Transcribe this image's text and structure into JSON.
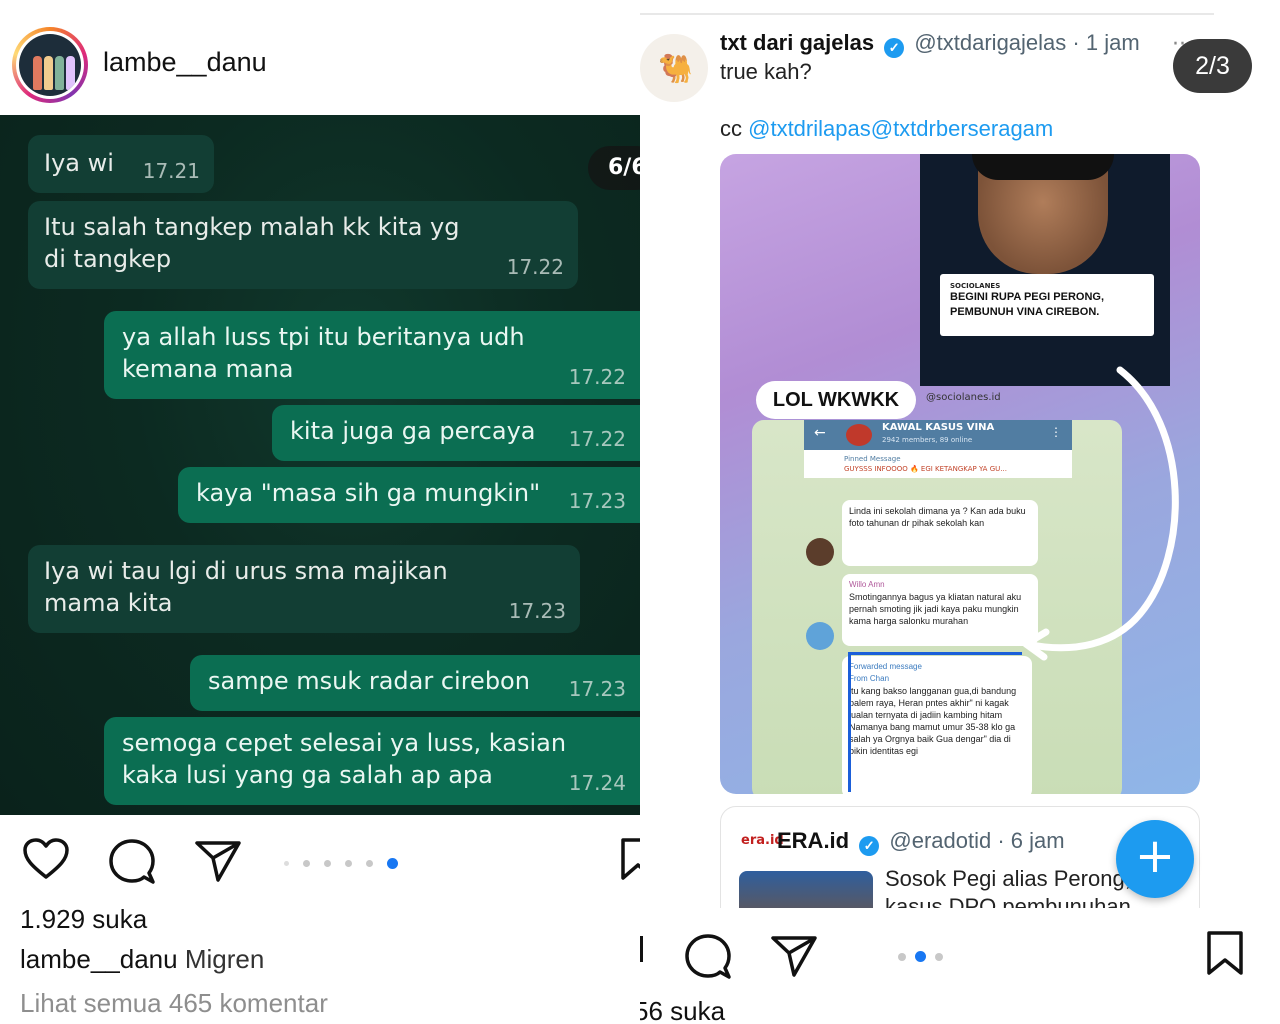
{
  "left_post": {
    "username": "lambe__danu",
    "slide_counter": "6/6",
    "messages": [
      {
        "dir": "in",
        "text": "Iya wi",
        "time": "17.21"
      },
      {
        "dir": "in",
        "text": "Itu salah tangkep malah kk kita yg di tangkep",
        "time": "17.22"
      },
      {
        "dir": "out",
        "text": "ya allah luss  tpi itu beritanya udh kemana mana",
        "time": "17.22"
      },
      {
        "dir": "out",
        "text": "kita juga ga percaya",
        "time": "17.22"
      },
      {
        "dir": "out",
        "text": "kaya \"masa sih ga mungkin\"",
        "time": "17.23"
      },
      {
        "dir": "in",
        "text": "Iya wi tau lgi di urus sma majikan mama kita",
        "time": "17.23"
      },
      {
        "dir": "out",
        "text": "sampe msuk radar cirebon",
        "time": "17.23"
      },
      {
        "dir": "out",
        "text": "semoga cepet selesai ya luss, kasian kaka lusi yang ga salah ap apa",
        "time": "17.24"
      }
    ],
    "likes": "1.929 suka",
    "caption_user": "lambe__danu",
    "caption_text": "Migren",
    "view_comments": "Lihat semua 465 komentar",
    "carousel_active_index": 5,
    "carousel_count": 6
  },
  "right_post": {
    "tweet": {
      "name": "txt dari gajelas",
      "handle": "@txtdarigajelas",
      "time": "· 1 jam",
      "text": "true kah?",
      "cc_prefix": "cc",
      "mention1": "@txtdrilapas",
      "mention2": "@txtdrberseragam",
      "more": "···"
    },
    "slide_counter": "2/3",
    "media": {
      "brand": "SOCIOLANES",
      "headline": "BEGINI RUPA PEGI PERONG, PEMBUNUH VINA CIREBON.",
      "sticker": "LOL WKWKK",
      "source": "@sociolanes.id",
      "tg_title": "KAWAL KASUS VINA",
      "tg_sub": "2942 members, 89 online",
      "tg_pinned_label": "Pinned Message",
      "tg_pinned_text": "GUYSSS INFOOOO 🔥 EGI KETANGKAP YA GU...",
      "tg_msg1": "Linda ini sekolah dimana ya ? Kan ada buku foto tahunan dr pihak sekolah kan",
      "tg_msg2_name": "Willo Amn",
      "tg_msg2": "Smotingannya bagus ya kliatan natural aku pernah smoting jik jadi kaya paku mungkin kama harga salonku murahan",
      "tg_fwd": "Forwarded message",
      "tg_from": "From Chan",
      "tg_msg3": "itu kang bakso langganan gua,di bandung palem raya, Heran pntes akhir\" ni kagak jualan ternyata di jadiin kambing hitam Namanya bang mamut umur 35-38 klo ga salah ya Orgnya baik Gua dengar\" dia di bikin identitas egi"
    },
    "quote": {
      "logo": "era.id",
      "name": "ERA.id",
      "handle": "@eradotid",
      "time": "· 6 jam",
      "text": "Sosok Pegi alias Perong, kasus DPO pembunuhan"
    },
    "fab_label": "+",
    "likes_partial": "56 suka",
    "carousel_active_index": 1,
    "carousel_count": 3
  },
  "colors": {
    "instagram_blue": "#1877f2",
    "twitter_blue": "#1d9bf0",
    "chat_bg": "#0c2a21",
    "bubble_out": "#0b6e52",
    "bubble_in": "#123e34"
  }
}
